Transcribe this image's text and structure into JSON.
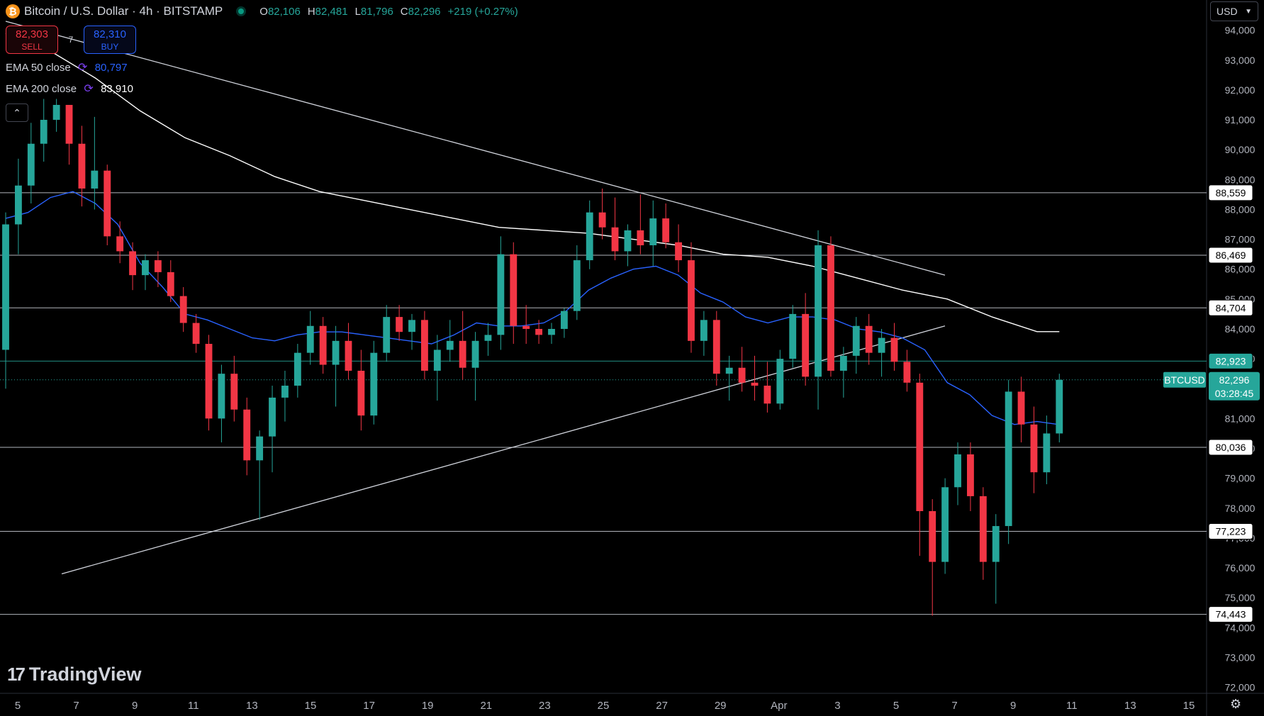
{
  "header": {
    "symbol": "Bitcoin / U.S. Dollar · 4h · BITSTAMP",
    "logo_letter": "₿",
    "open_label": "O",
    "open": "82,106",
    "high_label": "H",
    "high": "82,481",
    "low_label": "L",
    "low": "81,796",
    "close_label": "C",
    "close": "82,296",
    "change": "+219 (+0.27%)"
  },
  "trade": {
    "sell_price": "82,303",
    "sell_label": "SELL",
    "spread": "7",
    "buy_price": "82,310",
    "buy_label": "BUY"
  },
  "indicators": [
    {
      "label": "EMA 50 close",
      "value": "80,797",
      "color": "#2962ff"
    },
    {
      "label": "EMA 200 close",
      "value": "83,910",
      "color": "#ffffff"
    }
  ],
  "currency": "USD",
  "brand": "TradingView",
  "chart_data": {
    "type": "candlestick",
    "ylim": [
      71800,
      94300
    ],
    "y_ticks": [
      "72,000",
      "73,000",
      "74,000",
      "75,000",
      "76,000",
      "77,000",
      "78,000",
      "79,000",
      "80,000",
      "81,000",
      "82,000",
      "83,000",
      "84,000",
      "85,000",
      "86,000",
      "87,000",
      "88,000",
      "89,000",
      "90,000",
      "91,000",
      "92,000",
      "93,000",
      "94,000"
    ],
    "x_ticks": [
      "5",
      "7",
      "9",
      "11",
      "13",
      "15",
      "17",
      "19",
      "21",
      "23",
      "25",
      "27",
      "29",
      "Apr",
      "3",
      "5",
      "7",
      "9",
      "11",
      "13",
      "15"
    ],
    "horizontal_levels": [
      {
        "label": "88,559",
        "value": 88559,
        "color": "#d1d4dc"
      },
      {
        "label": "86,469",
        "value": 86469,
        "color": "#d1d4dc"
      },
      {
        "label": "84,704",
        "value": 84704,
        "color": "#d1d4dc"
      },
      {
        "label": "82,923",
        "value": 82923,
        "color": "#26a69a"
      },
      {
        "label": "80,036",
        "value": 80036,
        "color": "#d1d4dc"
      },
      {
        "label": "77,223",
        "value": 77223,
        "color": "#d1d4dc"
      },
      {
        "label": "74,443",
        "value": 74443,
        "color": "#d1d4dc"
      }
    ],
    "current_price": {
      "symbol": "BTCUSD",
      "label": "82,296",
      "value": 82296,
      "countdown": "03:28:45",
      "color": "#26a69a"
    },
    "trendlines": [
      {
        "name": "descending",
        "points": [
          [
            0.0,
            94300
          ],
          [
            41.9,
            85800
          ]
        ]
      },
      {
        "name": "ascending",
        "points": [
          [
            2.5,
            75800
          ],
          [
            41.9,
            84100
          ]
        ]
      }
    ],
    "ema50": [
      [
        0,
        87700
      ],
      [
        1,
        87900
      ],
      [
        2,
        88400
      ],
      [
        3,
        88600
      ],
      [
        4,
        88200
      ],
      [
        5,
        87500
      ],
      [
        6,
        86200
      ],
      [
        7,
        85400
      ],
      [
        8,
        84500
      ],
      [
        9,
        84300
      ],
      [
        10,
        84000
      ],
      [
        11,
        83700
      ],
      [
        12,
        83600
      ],
      [
        13,
        83800
      ],
      [
        14,
        83900
      ],
      [
        15,
        83900
      ],
      [
        16,
        83800
      ],
      [
        17,
        83700
      ],
      [
        18,
        83600
      ],
      [
        19,
        83500
      ],
      [
        20,
        83800
      ],
      [
        21,
        84200
      ],
      [
        22,
        84100
      ],
      [
        23,
        84100
      ],
      [
        24,
        84200
      ],
      [
        25,
        84600
      ],
      [
        26,
        85300
      ],
      [
        27,
        85700
      ],
      [
        28,
        86000
      ],
      [
        29,
        86100
      ],
      [
        30,
        85800
      ],
      [
        31,
        85200
      ],
      [
        32,
        84900
      ],
      [
        33,
        84400
      ],
      [
        34,
        84200
      ],
      [
        35,
        84400
      ],
      [
        36,
        84400
      ],
      [
        37,
        84300
      ],
      [
        38,
        84000
      ],
      [
        39,
        83900
      ],
      [
        40,
        83700
      ],
      [
        41,
        83300
      ],
      [
        42,
        82200
      ],
      [
        43,
        81800
      ],
      [
        44,
        81100
      ],
      [
        45,
        80800
      ],
      [
        46,
        80900
      ],
      [
        47,
        80797
      ]
    ],
    "ema200": [
      [
        0,
        93900
      ],
      [
        2,
        93300
      ],
      [
        4,
        92400
      ],
      [
        6,
        91300
      ],
      [
        8,
        90400
      ],
      [
        10,
        89800
      ],
      [
        12,
        89100
      ],
      [
        14,
        88600
      ],
      [
        16,
        88300
      ],
      [
        18,
        88000
      ],
      [
        20,
        87700
      ],
      [
        22,
        87400
      ],
      [
        24,
        87300
      ],
      [
        26,
        87200
      ],
      [
        28,
        87000
      ],
      [
        30,
        86800
      ],
      [
        32,
        86500
      ],
      [
        34,
        86400
      ],
      [
        36,
        86100
      ],
      [
        38,
        85700
      ],
      [
        40,
        85300
      ],
      [
        42,
        85000
      ],
      [
        44,
        84400
      ],
      [
        46,
        83910
      ],
      [
        47,
        83910
      ]
    ],
    "candles": [
      [
        83300,
        87900,
        82000,
        87500
      ],
      [
        87500,
        89700,
        86500,
        88800
      ],
      [
        88800,
        90900,
        88200,
        90200
      ],
      [
        90200,
        91700,
        89600,
        91000
      ],
      [
        91000,
        91700,
        90600,
        91500
      ],
      [
        91500,
        91300,
        89500,
        90200
      ],
      [
        90200,
        90800,
        88100,
        88700
      ],
      [
        88700,
        91100,
        88000,
        89300
      ],
      [
        89300,
        89500,
        86800,
        87100
      ],
      [
        87100,
        87600,
        86200,
        86600
      ],
      [
        86600,
        86900,
        85300,
        85800
      ],
      [
        85800,
        86500,
        85300,
        86300
      ],
      [
        86300,
        86600,
        85400,
        85900
      ],
      [
        85900,
        86300,
        84900,
        85100
      ],
      [
        85100,
        85400,
        83900,
        84200
      ],
      [
        84200,
        84500,
        83200,
        83500
      ],
      [
        83500,
        83800,
        80600,
        81000
      ],
      [
        81000,
        82800,
        80200,
        82500
      ],
      [
        82500,
        83100,
        80900,
        81300
      ],
      [
        81300,
        81700,
        79100,
        79600
      ],
      [
        79600,
        80600,
        77600,
        80400
      ],
      [
        80400,
        82100,
        79200,
        81700
      ],
      [
        81700,
        82600,
        80900,
        82100
      ],
      [
        82100,
        83500,
        81700,
        83200
      ],
      [
        83200,
        84600,
        82800,
        84100
      ],
      [
        84100,
        84400,
        82500,
        82800
      ],
      [
        82800,
        84100,
        81400,
        83600
      ],
      [
        83600,
        84200,
        82300,
        82600
      ],
      [
        82600,
        83300,
        80600,
        81100
      ],
      [
        81100,
        83600,
        80800,
        83200
      ],
      [
        83200,
        84800,
        82900,
        84400
      ],
      [
        84400,
        84800,
        83600,
        83900
      ],
      [
        83900,
        84500,
        83300,
        84300
      ],
      [
        84300,
        84600,
        82300,
        82600
      ],
      [
        82600,
        83800,
        81600,
        83300
      ],
      [
        83300,
        84300,
        82900,
        83600
      ],
      [
        83600,
        84600,
        82300,
        82700
      ],
      [
        82700,
        83900,
        81600,
        83600
      ],
      [
        83600,
        84200,
        83100,
        83800
      ],
      [
        83800,
        87100,
        83300,
        86500
      ],
      [
        86500,
        86900,
        83500,
        84100
      ],
      [
        84100,
        84800,
        83500,
        84000
      ],
      [
        84000,
        84300,
        83500,
        83800
      ],
      [
        83800,
        84200,
        83500,
        84000
      ],
      [
        84000,
        84700,
        83700,
        84600
      ],
      [
        84600,
        86800,
        84300,
        86300
      ],
      [
        86300,
        88300,
        86000,
        87900
      ],
      [
        87900,
        88700,
        87000,
        87400
      ],
      [
        87400,
        88400,
        86300,
        86600
      ],
      [
        86600,
        87500,
        86100,
        87300
      ],
      [
        87300,
        88500,
        86500,
        86800
      ],
      [
        86800,
        88300,
        86100,
        87700
      ],
      [
        87700,
        88200,
        86700,
        86900
      ],
      [
        86900,
        87500,
        85900,
        86300
      ],
      [
        86300,
        86900,
        83200,
        83600
      ],
      [
        83600,
        84600,
        83100,
        84300
      ],
      [
        84300,
        84600,
        82100,
        82500
      ],
      [
        82500,
        83100,
        81600,
        82700
      ],
      [
        82700,
        83400,
        81900,
        82200
      ],
      [
        82200,
        83100,
        81600,
        82100
      ],
      [
        82100,
        82900,
        81200,
        81500
      ],
      [
        81500,
        83300,
        81300,
        83000
      ],
      [
        83000,
        84800,
        82700,
        84500
      ],
      [
        84500,
        85200,
        82100,
        82400
      ],
      [
        82400,
        87300,
        81300,
        86800
      ],
      [
        86800,
        87100,
        82400,
        82600
      ],
      [
        82600,
        83400,
        81700,
        83100
      ],
      [
        83100,
        84400,
        82500,
        84100
      ],
      [
        84100,
        84500,
        82800,
        83200
      ],
      [
        83200,
        84000,
        82400,
        83700
      ],
      [
        83700,
        84200,
        82600,
        82900
      ],
      [
        82900,
        83300,
        81900,
        82200
      ],
      [
        82200,
        82500,
        76400,
        77900
      ],
      [
        77900,
        78300,
        74400,
        76200
      ],
      [
        76200,
        79000,
        75800,
        78700
      ],
      [
        78700,
        80200,
        78100,
        79800
      ],
      [
        79800,
        80200,
        77900,
        78400
      ],
      [
        78400,
        78700,
        75600,
        76200
      ],
      [
        76200,
        77800,
        74800,
        77400
      ],
      [
        77400,
        82300,
        76800,
        81900
      ],
      [
        81900,
        82400,
        80200,
        80800
      ],
      [
        80800,
        81400,
        78500,
        79200
      ],
      [
        79200,
        81100,
        78800,
        80500
      ],
      [
        80500,
        82500,
        80200,
        82296
      ]
    ]
  }
}
